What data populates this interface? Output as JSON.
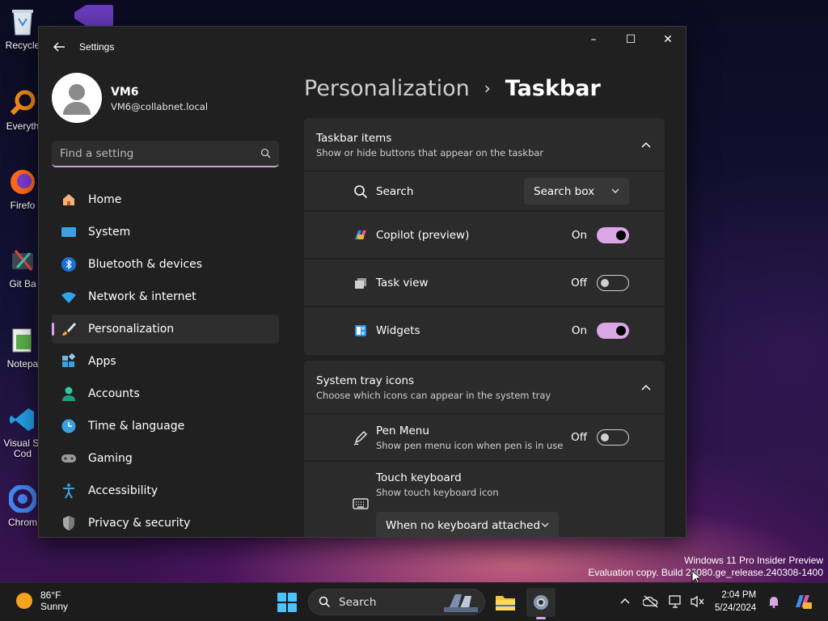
{
  "desktop": {
    "icons": [
      {
        "label": "Recycle"
      },
      {
        "label": "Everyth"
      },
      {
        "label": "Firefo"
      },
      {
        "label": "Git Ba"
      },
      {
        "label": "Notepa"
      },
      {
        "label": "Visual St",
        "label2": "Cod"
      },
      {
        "label": "Chrom"
      }
    ],
    "watermark": {
      "line1": "Windows 11 Pro Insider Preview",
      "line2": "Evaluation copy. Build 26080.ge_release.240308-1400"
    }
  },
  "window": {
    "title": "Settings",
    "controls": {
      "minimize": "–",
      "maximize": "☐",
      "close": "✕"
    }
  },
  "profile": {
    "name": "VM6",
    "email": "VM6@collabnet.local"
  },
  "search": {
    "placeholder": "Find a setting"
  },
  "nav": {
    "items": [
      {
        "label": "Home",
        "icon": "home-icon"
      },
      {
        "label": "System",
        "icon": "system-icon"
      },
      {
        "label": "Bluetooth & devices",
        "icon": "bluetooth-icon"
      },
      {
        "label": "Network & internet",
        "icon": "network-icon"
      },
      {
        "label": "Personalization",
        "icon": "brush-icon",
        "selected": true
      },
      {
        "label": "Apps",
        "icon": "apps-icon"
      },
      {
        "label": "Accounts",
        "icon": "accounts-icon"
      },
      {
        "label": "Time & language",
        "icon": "time-icon"
      },
      {
        "label": "Gaming",
        "icon": "gaming-icon"
      },
      {
        "label": "Accessibility",
        "icon": "accessibility-icon"
      },
      {
        "label": "Privacy & security",
        "icon": "shield-icon"
      }
    ]
  },
  "breadcrumb": {
    "parent": "Personalization",
    "separator": "›",
    "current": "Taskbar"
  },
  "taskbar_items": {
    "title": "Taskbar items",
    "subtitle": "Show or hide buttons that appear on the taskbar",
    "rows": [
      {
        "label": "Search",
        "icon": "search-icon",
        "dropdown": "Search box"
      },
      {
        "label": "Copilot (preview)",
        "icon": "copilot-icon",
        "state": "On",
        "on": true
      },
      {
        "label": "Task view",
        "icon": "task-view-icon",
        "state": "Off",
        "on": false
      },
      {
        "label": "Widgets",
        "icon": "widgets-icon",
        "state": "On",
        "on": true
      }
    ]
  },
  "system_tray": {
    "title": "System tray icons",
    "subtitle": "Choose which icons can appear in the system tray",
    "pen": {
      "label": "Pen Menu",
      "desc": "Show pen menu icon when pen is in use",
      "state": "Off",
      "on": false
    },
    "touch": {
      "label": "Touch keyboard",
      "desc": "Show touch keyboard icon",
      "dropdown": "When no keyboard attached"
    }
  },
  "taskbar": {
    "weather": {
      "temp": "86°F",
      "condition": "Sunny"
    },
    "search_label": "Search",
    "clock": {
      "time": "2:04 PM",
      "date": "5/24/2024"
    }
  },
  "colors": {
    "accent": "#d9a6e6",
    "window_bg": "#202020",
    "card_bg": "#2b2b2b"
  }
}
